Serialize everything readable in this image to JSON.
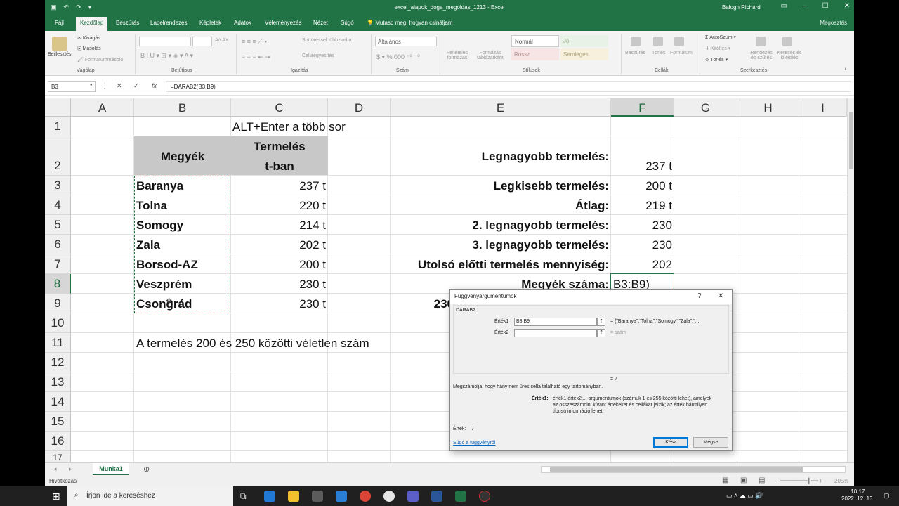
{
  "window": {
    "title": "excel_alapok_doga_megoldas_1213 - Excel",
    "user": "Balogh Richárd"
  },
  "ribbon": {
    "tabs": [
      "Fájl",
      "Kezdőlap",
      "Beszúrás",
      "Lapelrendezés",
      "Képletek",
      "Adatok",
      "Véleményezés",
      "Nézet",
      "Súgó"
    ],
    "tell_me": "Mutasd meg, hogyan csináljam",
    "share": "Megosztás",
    "clipboard": {
      "paste": "Beillesztés",
      "cut": "Kivágás",
      "copy": "Másolás",
      "format_painter": "Formátummásoló",
      "label": "Vágólap"
    },
    "font": {
      "label": "Betűtípus"
    },
    "alignment": {
      "wrap": "Sortöréssel több sorba",
      "merge": "Cellaegyesítés",
      "label": "Igazítás"
    },
    "number": {
      "format": "Általános",
      "label": "Szám"
    },
    "styles": {
      "conditional": "Feltételes formázás",
      "table": "Formázás táblázatként",
      "normal": "Normál",
      "good": "Jó",
      "bad": "Rossz",
      "neutral": "Semleges",
      "label": "Stílusok"
    },
    "cells": {
      "insert": "Beszúrás",
      "delete": "Törlés",
      "format": "Formátum",
      "label": "Cellák"
    },
    "editing": {
      "autosum": "AutoSzum",
      "fill": "Kitöltés",
      "clear": "Törlés",
      "sort": "Rendezés és szűrés",
      "find": "Keresés és kijelölés",
      "label": "Szerkesztés"
    }
  },
  "formula_bar": {
    "name_box": "B3",
    "formula": "=DARAB2(B3:B9)"
  },
  "grid": {
    "columns": [
      "A",
      "B",
      "C",
      "D",
      "E",
      "F",
      "G",
      "H",
      "I"
    ],
    "rows": [
      "1",
      "2",
      "3",
      "4",
      "5",
      "6",
      "7",
      "8",
      "9",
      "10",
      "11",
      "12",
      "13",
      "14",
      "15",
      "16",
      "17"
    ],
    "c1": "ALT+Enter a több sor",
    "b2": "Megyék",
    "c2_line1": "Termelés",
    "c2_line2": "t-ban",
    "counties": [
      "Baranya",
      "Tolna",
      "Somogy",
      "Zala",
      "Borsod-AZ",
      "Veszprém",
      "Csongrád"
    ],
    "production": [
      "237 t",
      "220 t",
      "214 t",
      "202 t",
      "200 t",
      "230 t",
      "230 t"
    ],
    "stats_labels": [
      "Legnagyobb termelés:",
      "Legkisebb termelés:",
      "Átlag:",
      "2. legnagyobb termelés:",
      "3. legnagyobb termelés:",
      "Utolsó előtti termelés mennyiség:",
      "Megyék száma:"
    ],
    "stats_values": [
      "237 t",
      "200 t",
      "219 t",
      "230",
      "230",
      "202",
      "B3:B9)"
    ],
    "d9": "230",
    "b11": "A termelés 200 és 250 közötti véletlen szám"
  },
  "dialog": {
    "title": "Függvényargumentumok",
    "help_glyph": "?",
    "close_glyph": "✕",
    "function": "DARAB2",
    "arg1_label": "Érték1",
    "arg1_value": "B3:B9",
    "arg1_result": "= {\"Baranya\";\"Tolna\";\"Somogy\";\"Zala\";\"...",
    "arg2_label": "Érték2",
    "arg2_result": "=  szám",
    "total": "=  7",
    "description": "Megszámolja, hogy hány nem üres cella található egy tartományban.",
    "param_label": "Érték1:",
    "param_desc_1": "érték1;érték2;... argumentumok (számuk 1 és 255 közötti lehet), amelyek",
    "param_desc_2": "az összeszámolni kívánt értékeket és cellákat jelzik; az érték bármilyen",
    "param_desc_3": "típusú információ lehet.",
    "result_label": "Érték:",
    "result_value": "7",
    "help_link": "Súgó a függvényről",
    "ok": "Kész",
    "cancel": "Mégse"
  },
  "sheet": {
    "tab": "Munka1",
    "add": "⊕",
    "status": "Hivatkozás",
    "zoom": "205%"
  },
  "taskbar": {
    "search_placeholder": "Írjon ide a kereséshez",
    "time": "10:17",
    "date": "2022. 12. 13."
  },
  "colors": {
    "accent": "#217346",
    "ribbon_bg": "#f3f3f3",
    "taskbar": "#202020"
  }
}
